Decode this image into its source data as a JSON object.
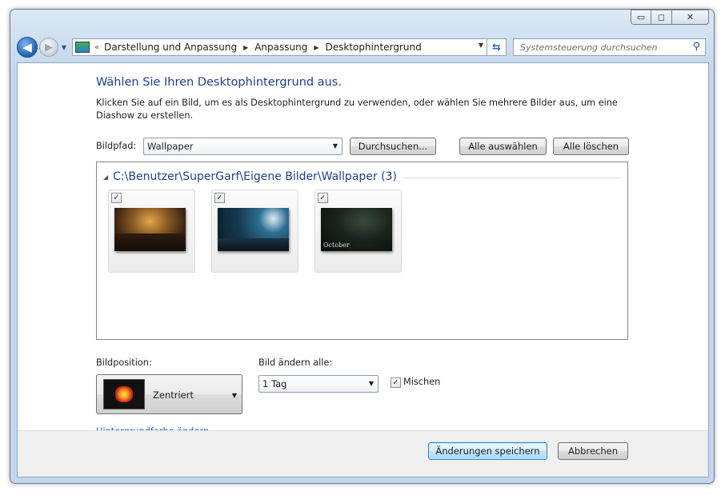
{
  "window": {
    "caption": {
      "minimize": "▭",
      "maximize": "◻",
      "close": "✕"
    }
  },
  "nav": {
    "back_icon": "◀",
    "forward_icon": "▶",
    "chevron": "«",
    "breadcrumbs": [
      "Darstellung und Anpassung",
      "Anpassung",
      "Desktophintergrund"
    ],
    "search_placeholder": "Systemsteuerung durchsuchen"
  },
  "main": {
    "title": "Wählen Sie Ihren Desktophintergrund aus.",
    "subtitle": "Klicken Sie auf ein Bild, um es als Desktophintergrund zu verwenden, oder wählen Sie mehrere Bilder aus, um eine Diashow zu erstellen.",
    "bildpfad_label": "Bildpfad:",
    "bildpfad_value": "Wallpaper",
    "browse_button": "Durchsuchen...",
    "select_all_button": "Alle auswählen",
    "clear_all_button": "Alle löschen",
    "group_title": "C:\\Benutzer\\SuperGarf\\Eigene Bilder\\Wallpaper (3)",
    "thumbnails": [
      {
        "checked": "✓"
      },
      {
        "checked": "✓"
      },
      {
        "checked": "✓",
        "caption": "October"
      }
    ],
    "position_label": "Bildposition:",
    "position_value": "Zentriert",
    "interval_label": "Bild ändern alle:",
    "interval_value": "1 Tag",
    "shuffle_label": "Mischen",
    "shuffle_checked": "✓",
    "bg_color_link": "Hintergrundfarbe ändern"
  },
  "footer": {
    "save_button": "Änderungen speichern",
    "cancel_button": "Abbrechen"
  },
  "colors": {
    "accent": "#1c3f94",
    "link": "#1f5fbf"
  }
}
